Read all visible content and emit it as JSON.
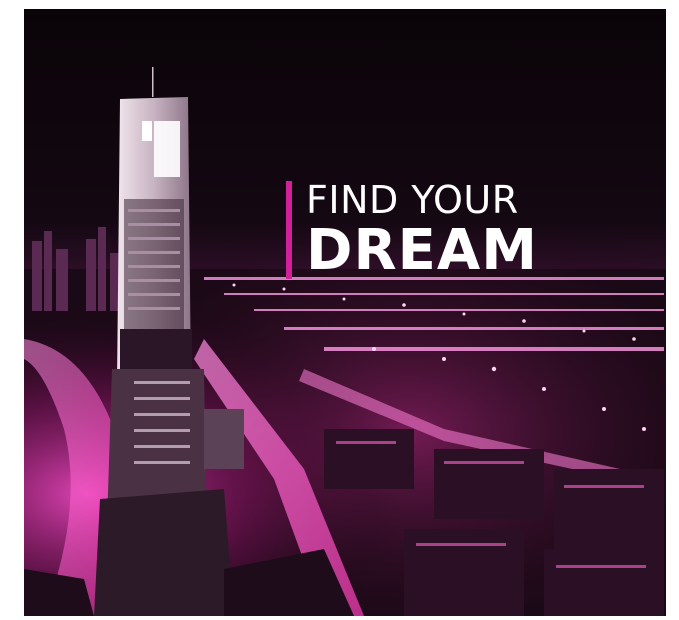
{
  "poster": {
    "headline_line1": "FIND YOUR",
    "headline_line2": "DREAM"
  },
  "colors": {
    "background": "#0b0509",
    "accent_magenta": "#d21f9a",
    "text": "#ffffff"
  }
}
